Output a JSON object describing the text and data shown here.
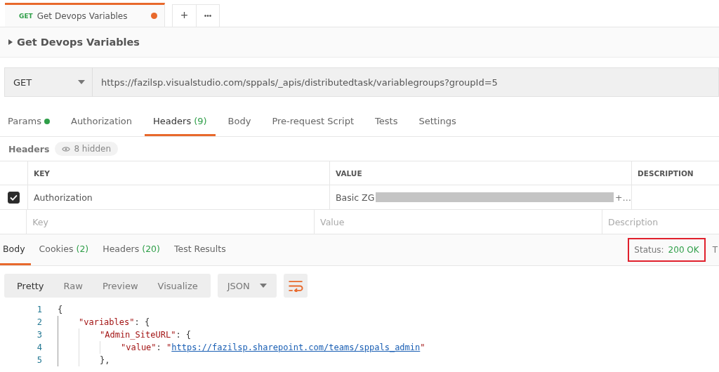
{
  "tabs": [
    {
      "method": "GET",
      "label": "Get Devops Variables",
      "unsaved": true,
      "selected": true
    }
  ],
  "tab_actions": [
    "+",
    "•••"
  ],
  "request": {
    "title": "Get Devops Variables",
    "expanded": false,
    "method": "GET",
    "url": "https://fazilsp.visualstudio.com/sppals/_apis/distributedtask/variablegroups?groupId=5"
  },
  "request_tabs": [
    {
      "label": "Params",
      "dot": true,
      "selected": false
    },
    {
      "label": "Authorization",
      "dot": false,
      "selected": false
    },
    {
      "label": "Headers",
      "count": "(9)",
      "dot": false,
      "selected": true
    },
    {
      "label": "Body",
      "dot": false,
      "selected": false
    },
    {
      "label": "Pre-request Script",
      "dot": false,
      "selected": false
    },
    {
      "label": "Tests",
      "dot": false,
      "selected": false
    },
    {
      "label": "Settings",
      "dot": false,
      "selected": false
    }
  ],
  "headers": {
    "label": "Headers",
    "hidden": "8 hidden",
    "columns": [
      "KEY",
      "VALUE",
      "DESCRIPTION"
    ],
    "rows": [
      {
        "checked": true,
        "key": "Authorization",
        "value": "Basic ZG",
        "redacted": true,
        "value_end": "+…"
      }
    ],
    "new_row": [
      {
        "placeholder": "Key"
      },
      {
        "placeholder": "Value"
      },
      {
        "placeholder": "Description"
      }
    ]
  },
  "response_tabs": [
    {
      "label": "Body",
      "selected": true
    },
    {
      "label": "Cookies",
      "count": "(2)",
      "selected": false
    },
    {
      "label": "Headers",
      "count": "(20)",
      "selected": false
    },
    {
      "label": "Test Results",
      "selected": false
    }
  ],
  "status": {
    "label": "Status:",
    "value": "200 OK",
    "highlighted": true,
    "next": "T"
  },
  "view_modes": [
    {
      "label": "Pretty",
      "selected": true
    },
    {
      "label": "Raw",
      "selected": false
    },
    {
      "label": "Preview",
      "selected": false
    },
    {
      "label": "Visualize",
      "selected": false
    }
  ],
  "format": "JSON",
  "code": [
    {
      "n": "1",
      "parts": [
        {
          "kind": "punct",
          "text": "{"
        }
      ],
      "children": [
        {
          "n": "2",
          "parts": [
            {
              "kind": "key",
              "text": "\"variables\""
            },
            {
              "kind": "punct",
              "text": ": {"
            }
          ],
          "children": [
            {
              "n": "3",
              "parts": [
                {
                  "kind": "key",
                  "text": "\"Admin_SiteURL\""
                },
                {
                  "kind": "punct",
                  "text": ": {"
                }
              ],
              "children": [
                {
                  "n": "4",
                  "parts": [
                    {
                      "kind": "key",
                      "text": "\"value\""
                    },
                    {
                      "kind": "punct",
                      "text": ": "
                    },
                    {
                      "kind": "string",
                      "text": "\""
                    },
                    {
                      "kind": "link",
                      "text": "https://fazilsp.sharepoint.com/teams/sppals_admin"
                    },
                    {
                      "kind": "string",
                      "text": "\""
                    }
                  ]
                }
              ]
            },
            {
              "n": "5",
              "parts": [
                {
                  "kind": "punct",
                  "text": "},"
                }
              ]
            }
          ]
        }
      ]
    }
  ]
}
